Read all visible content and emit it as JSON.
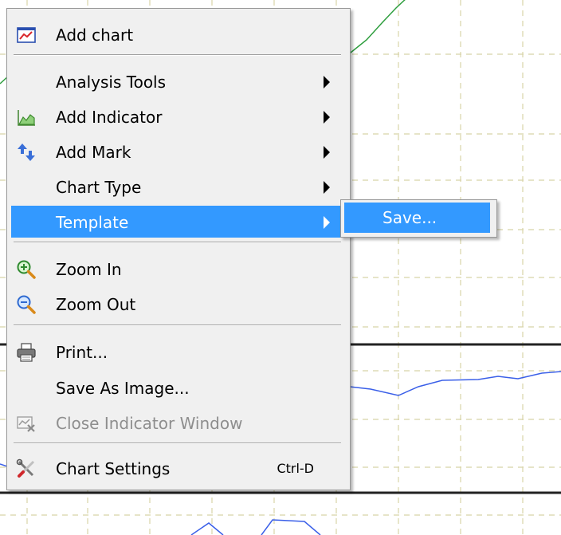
{
  "context_menu": {
    "items": [
      {
        "label": "Add chart",
        "icon": "add-chart-icon"
      },
      {
        "label": "Analysis Tools",
        "has_submenu": true
      },
      {
        "label": "Add Indicator",
        "icon": "indicator-icon",
        "has_submenu": true
      },
      {
        "label": "Add Mark",
        "icon": "add-mark-icon",
        "has_submenu": true
      },
      {
        "label": "Chart Type",
        "has_submenu": true
      },
      {
        "label": "Template",
        "has_submenu": true,
        "highlighted": true
      },
      {
        "label": "Zoom In",
        "icon": "zoom-in-icon"
      },
      {
        "label": "Zoom Out",
        "icon": "zoom-out-icon"
      },
      {
        "label": "Print...",
        "icon": "printer-icon"
      },
      {
        "label": "Save As Image..."
      },
      {
        "label": "Close Indicator Window",
        "icon": "close-indicator-icon",
        "disabled": true
      },
      {
        "label": "Chart Settings",
        "icon": "settings-tools-icon",
        "shortcut": "Ctrl-D"
      }
    ]
  },
  "submenu": {
    "items": [
      {
        "label": "Save...",
        "highlighted": true
      }
    ]
  },
  "colors": {
    "highlight": "#3399ff",
    "menu_background": "#f0f0f0",
    "grid_dash": "#d8d4a8",
    "green_line": "#2e9e3e",
    "blue_line": "#3a5fe8",
    "panel_divider": "#222222"
  }
}
